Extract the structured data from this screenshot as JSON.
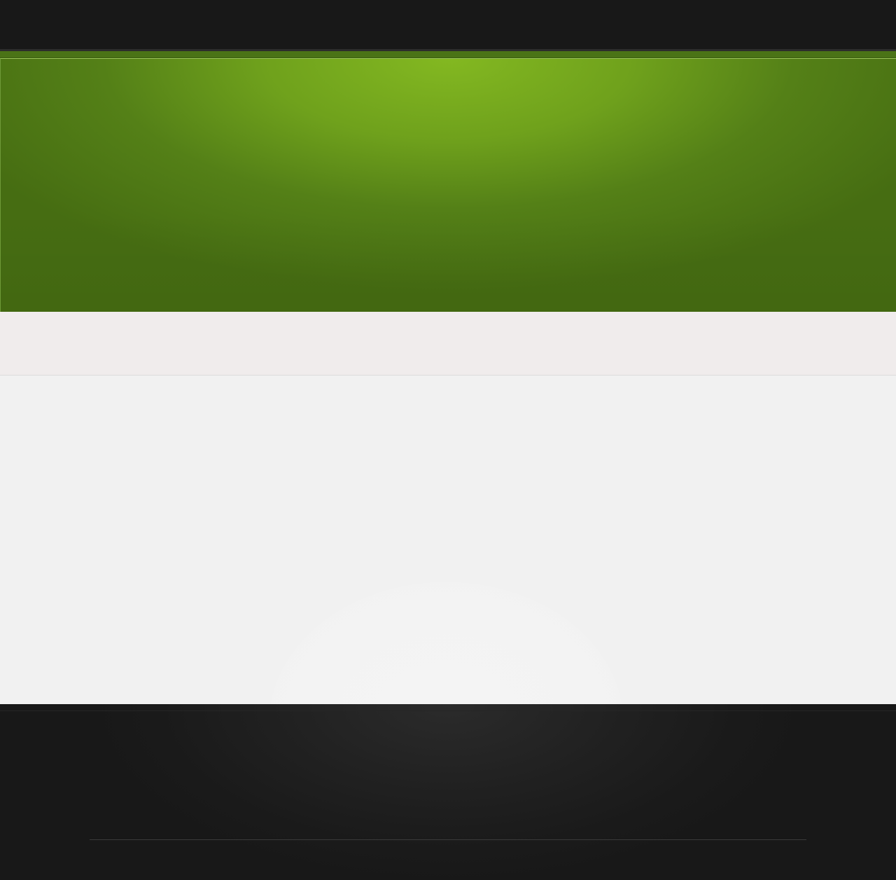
{
  "colors": {
    "topbar": "#181818",
    "accent_green": "#6fa11c",
    "accent_green_light": "#83b821",
    "accent_green_dark": "#466d12",
    "subbar": "#f0ecec",
    "content": "#f1f1f1",
    "footer": "#181818"
  }
}
